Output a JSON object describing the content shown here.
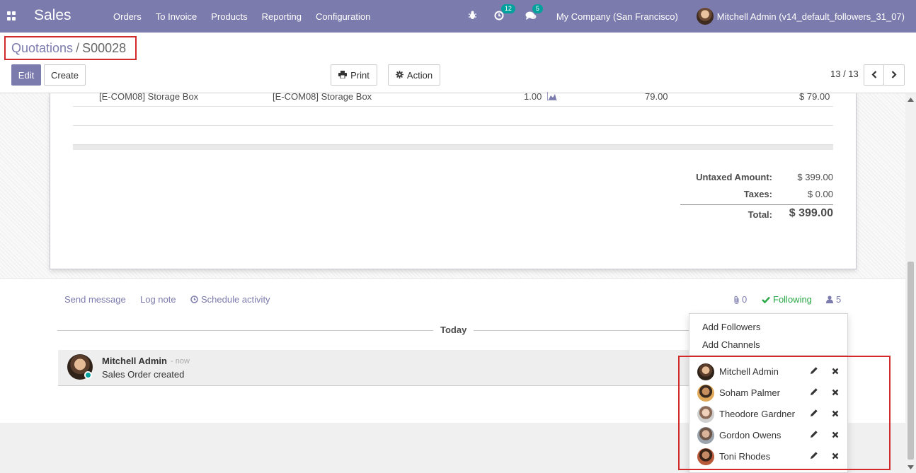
{
  "navbar": {
    "app_title": "Sales",
    "menu": [
      "Orders",
      "To Invoice",
      "Products",
      "Reporting",
      "Configuration"
    ],
    "activity_count": "12",
    "message_count": "5",
    "company": "My Company (San Francisco)",
    "user": "Mitchell Admin (v14_default_followers_31_07)"
  },
  "breadcrumb": {
    "parent": "Quotations",
    "separator": "/",
    "current": "S00028"
  },
  "buttons": {
    "edit": "Edit",
    "create": "Create",
    "print": "Print",
    "action": "Action"
  },
  "pager": {
    "value": "13 / 13"
  },
  "order_line": {
    "product": "[E-COM08] Storage Box",
    "description": "[E-COM08] Storage Box",
    "quantity": "1.00",
    "unit_price": "79.00",
    "subtotal": "$ 79.00"
  },
  "totals": {
    "untaxed_label": "Untaxed Amount:",
    "untaxed_value": "$ 399.00",
    "taxes_label": "Taxes:",
    "taxes_value": "$ 0.00",
    "total_label": "Total:",
    "total_value": "$ 399.00"
  },
  "chatter": {
    "send_message": "Send message",
    "log_note": "Log note",
    "schedule_activity": "Schedule activity",
    "attachments_count": "0",
    "following": "Following",
    "followers_count": "5",
    "date_separator": "Today"
  },
  "message": {
    "author": "Mitchell Admin",
    "time": "- now",
    "body": "Sales Order created"
  },
  "followers_dropdown": {
    "add_followers": "Add Followers",
    "add_channels": "Add Channels",
    "followers": [
      {
        "name": "Mitchell Admin"
      },
      {
        "name": "Soham Palmer"
      },
      {
        "name": "Theodore Gardner"
      },
      {
        "name": "Gordon Owens"
      },
      {
        "name": "Toni Rhodes"
      }
    ]
  },
  "colors": {
    "brand": "#7c7bad",
    "accent": "#00a09d",
    "following": "#28a745",
    "highlight": "#d12a2a"
  }
}
